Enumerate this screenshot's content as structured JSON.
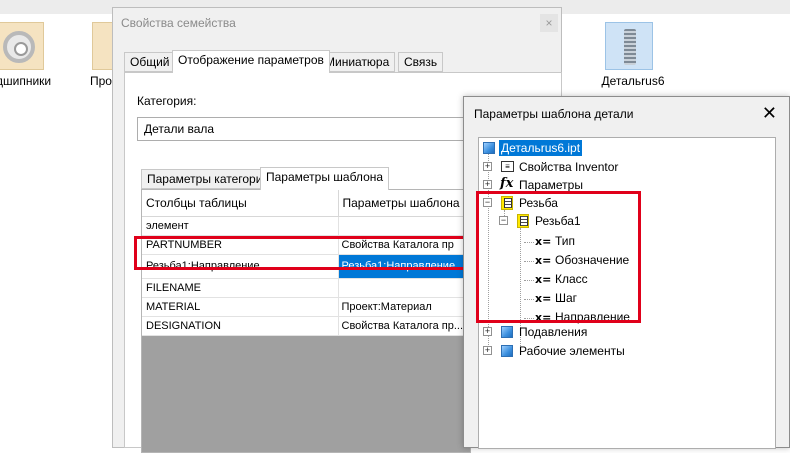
{
  "desktop": {
    "items": [
      {
        "label": "дшипники",
        "icon": "bearing-icon"
      },
      {
        "label": "Про",
        "icon": "folder-icon"
      },
      {
        "label": "Детальrus6",
        "icon": "bolt-part-icon"
      }
    ]
  },
  "family_dialog": {
    "title": "Свойства семейства",
    "close_label": "×",
    "tabs": [
      "Общий",
      "Отображение параметров",
      "Миниатюра",
      "Связь"
    ],
    "active_tab": "Отображение параметров",
    "category_label": "Категория:",
    "category_value": "Детали вала",
    "subtabs": [
      "Параметры категории",
      "Параметры шаблона"
    ],
    "active_subtab": "Параметры шаблона",
    "table": {
      "headers": [
        "Столбцы таблицы",
        "Параметры шаблона"
      ],
      "rows": [
        [
          "элемент",
          ""
        ],
        [
          "PARTNUMBER",
          "Свойства Каталога пр"
        ],
        [
          "Резьба1:Направление",
          "Резьба1:Направление"
        ],
        [
          "FILENAME",
          ""
        ],
        [
          "MATERIAL",
          "Проект:Материал"
        ],
        [
          "DESIGNATION",
          "Свойства Каталога пр..."
        ]
      ],
      "selected_row_index": 2
    }
  },
  "template_dialog": {
    "title": "Параметры шаблона детали",
    "close_label": "✕",
    "tree": {
      "root": "Детальrus6.ipt",
      "nodes": [
        {
          "label": "Свойства Inventor",
          "icon": "properties-icon"
        },
        {
          "label": "Параметры",
          "icon": "fx-icon"
        },
        {
          "label": "Резьба",
          "icon": "thread-icon"
        },
        {
          "label": "Резьба1",
          "icon": "thread-icon"
        },
        {
          "label": "Тип",
          "icon": "parameter-x-icon"
        },
        {
          "label": "Обозначение",
          "icon": "parameter-x-icon"
        },
        {
          "label": "Класс",
          "icon": "parameter-x-icon"
        },
        {
          "label": "Шаг",
          "icon": "parameter-x-icon"
        },
        {
          "label": "Направление",
          "icon": "parameter-x-icon"
        },
        {
          "label": "Подавления",
          "icon": "cube-icon"
        },
        {
          "label": "Рабочие элементы",
          "icon": "cube-icon"
        }
      ],
      "param_symbol": "x="
    }
  },
  "colors": {
    "selection": "#0078d7",
    "highlight_frame": "#e0001a",
    "thread_icon": "#ffe900"
  }
}
